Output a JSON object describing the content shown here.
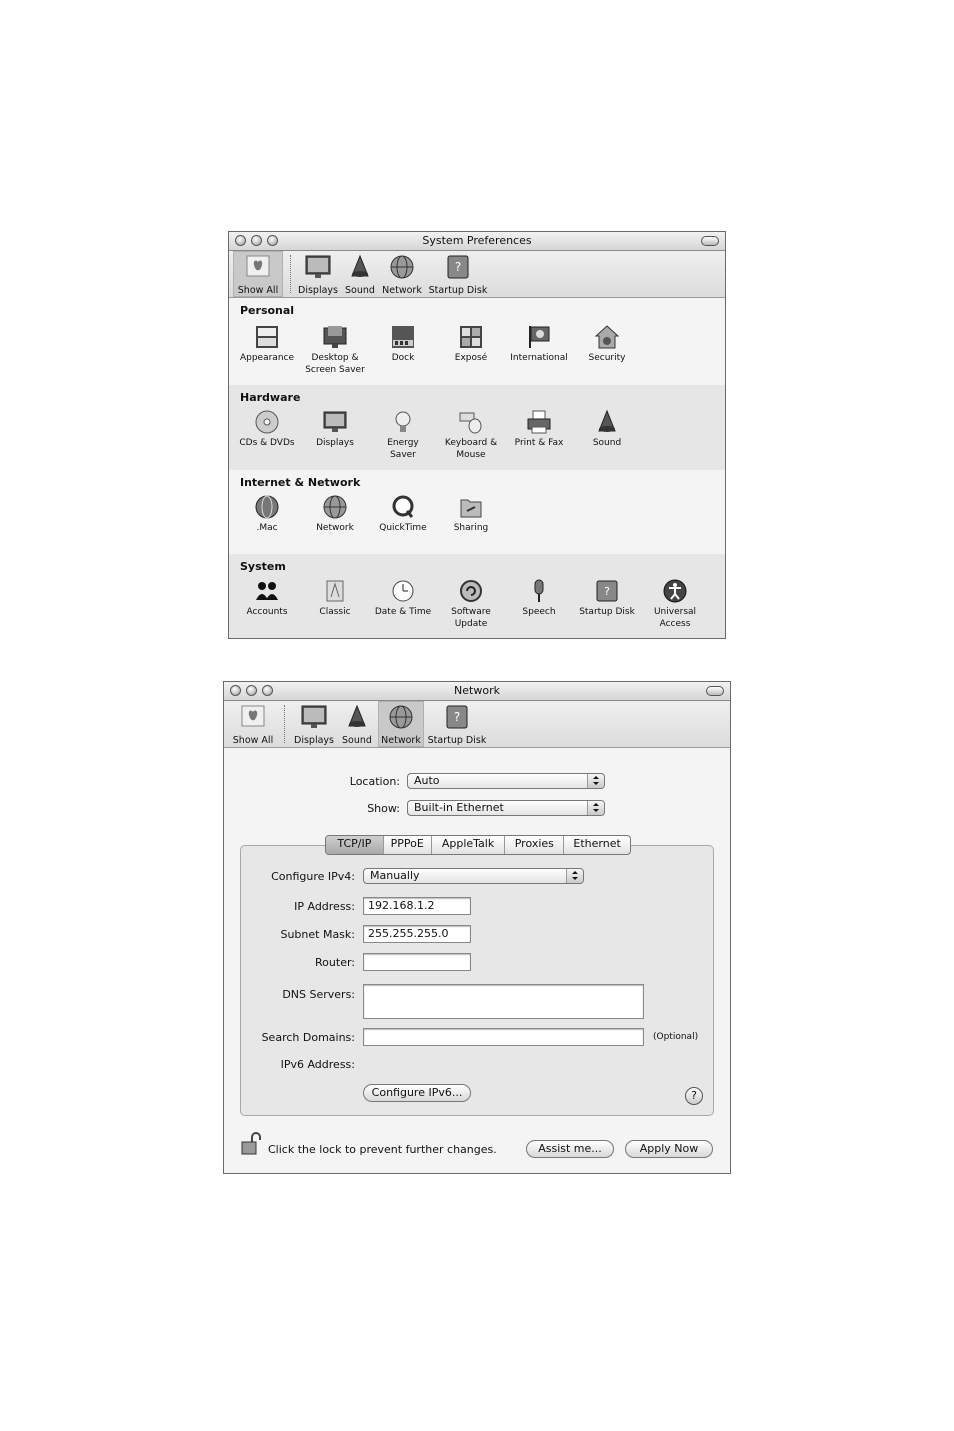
{
  "window1": {
    "title": "System Preferences",
    "toolbar": [
      "Show All",
      "Displays",
      "Sound",
      "Network",
      "Startup Disk"
    ],
    "sections": [
      {
        "title": "Personal",
        "items": [
          [
            "Appearance"
          ],
          [
            "Desktop &",
            "Screen Saver"
          ],
          [
            "Dock"
          ],
          [
            "Exposé"
          ],
          [
            "International"
          ],
          [
            "Security"
          ]
        ]
      },
      {
        "title": "Hardware",
        "items": [
          [
            "CDs & DVDs"
          ],
          [
            "Displays"
          ],
          [
            "Energy",
            "Saver"
          ],
          [
            "Keyboard &",
            "Mouse"
          ],
          [
            "Print & Fax"
          ],
          [
            "Sound"
          ]
        ]
      },
      {
        "title": "Internet & Network",
        "items": [
          [
            ".Mac"
          ],
          [
            "Network"
          ],
          [
            "QuickTime"
          ],
          [
            "Sharing"
          ]
        ]
      },
      {
        "title": "System",
        "items": [
          [
            "Accounts"
          ],
          [
            "Classic"
          ],
          [
            "Date & Time"
          ],
          [
            "Software",
            "Update"
          ],
          [
            "Speech"
          ],
          [
            "Startup Disk"
          ],
          [
            "Universal",
            "Access"
          ]
        ]
      }
    ]
  },
  "window2": {
    "title": "Network",
    "toolbar": [
      "Show All",
      "Displays",
      "Sound",
      "Network",
      "Startup Disk"
    ],
    "location_label": "Location:",
    "location_value": "Auto",
    "show_label": "Show:",
    "show_value": "Built-in Ethernet",
    "tabs": [
      "TCP/IP",
      "PPPoE",
      "AppleTalk",
      "Proxies",
      "Ethernet"
    ],
    "configure_label": "Configure IPv4:",
    "configure_value": "Manually",
    "ip_label": "IP Address:",
    "ip_value": "192.168.1.2",
    "subnet_label": "Subnet Mask:",
    "subnet_value": "255.255.255.0",
    "router_label": "Router:",
    "router_value": "",
    "dns_label": "DNS Servers:",
    "dns_value": "",
    "search_label": "Search Domains:",
    "search_value": "",
    "optional": "(Optional)",
    "ipv6_label": "IPv6 Address:",
    "configure_ipv6_button": "Configure IPv6...",
    "help": "?",
    "lock_text": "Click the lock to prevent further changes.",
    "assist_button": "Assist me...",
    "apply_button": "Apply Now"
  }
}
